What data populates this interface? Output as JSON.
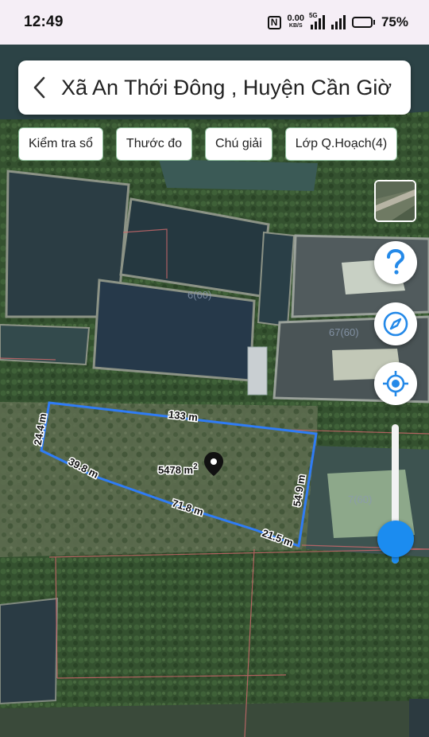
{
  "status_bar": {
    "time": "12:49",
    "net_speed_value": "0.00",
    "net_speed_unit": "KB/S",
    "network_tag": "5G",
    "battery_percent": "75%",
    "battery_level": 0.75
  },
  "header": {
    "title": "Xã An Thới Đông , Huyện Cần Giờ"
  },
  "toolbar": {
    "chips": [
      {
        "label": "Kiểm tra sổ"
      },
      {
        "label": "Thước đo"
      },
      {
        "label": "Chú giải"
      },
      {
        "label": "Lớp Q.Hoạch(4)"
      }
    ]
  },
  "parcel": {
    "area_label": "5478 m",
    "area_unit_sup": "2",
    "edges": [
      "133 m",
      "54.9 m",
      "21.5 m",
      "71.8 m",
      "39.8 m",
      "24.4 m"
    ]
  },
  "map_labels": {
    "parcel_a": "6(60)",
    "parcel_b": "67(60)",
    "parcel_c": "7(60)"
  },
  "zoom": {
    "level": 0.2
  },
  "colors": {
    "accent": "#1b8cf0",
    "boundary": "#2f7cf5",
    "chip_border": "#8fbf9c"
  }
}
